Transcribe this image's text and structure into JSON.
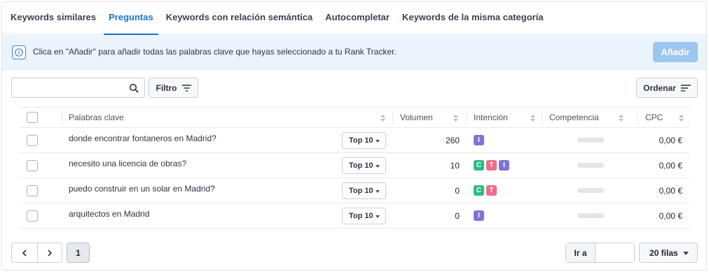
{
  "tabs": [
    {
      "label": "Keywords similares",
      "active": false
    },
    {
      "label": "Preguntas",
      "active": true
    },
    {
      "label": "Keywords con relación semántica",
      "active": false
    },
    {
      "label": "Autocompletar",
      "active": false
    },
    {
      "label": "Keywords de la misma categoría",
      "active": false
    }
  ],
  "banner": {
    "icon": "info-icon",
    "text": "Clica en \"Añadir\" para añadir todas las palabras clave que hayas seleccionado a tu Rank Tracker.",
    "add_label": "Añadir"
  },
  "toolbar": {
    "search_value": "",
    "search_icon": "search-icon",
    "filter_label": "Filtro",
    "sort_label": "Ordenar"
  },
  "table": {
    "columns": [
      "Palabras clave",
      "Volumen",
      "Intención",
      "Competencia",
      "CPC"
    ],
    "rows": [
      {
        "keyword": "donde encontrar fontaneros en Madrid?",
        "top": "Top 10",
        "volume": "260",
        "intent": [
          "I"
        ],
        "competition": "",
        "cpc": "0,00 €"
      },
      {
        "keyword": "necesito una licencia de obras?",
        "top": "Top 10",
        "volume": "10",
        "intent": [
          "C",
          "T",
          "I"
        ],
        "competition": "",
        "cpc": "0,00 €"
      },
      {
        "keyword": "puedo construir en un solar en Madrid?",
        "top": "Top 10",
        "volume": "0",
        "intent": [
          "C",
          "T"
        ],
        "competition": "",
        "cpc": "0,00 €"
      },
      {
        "keyword": "arquitectos en Madrid",
        "top": "Top 10",
        "volume": "0",
        "intent": [
          "I"
        ],
        "competition": "",
        "cpc": "0,00 €"
      }
    ]
  },
  "intent_colors": {
    "I": "#7f74d6",
    "C": "#2fb98a",
    "T": "#ee6d8a"
  },
  "pagination": {
    "current_page": "1",
    "goto_label": "Ir a",
    "goto_value": "",
    "rows_label": "20 filas"
  }
}
